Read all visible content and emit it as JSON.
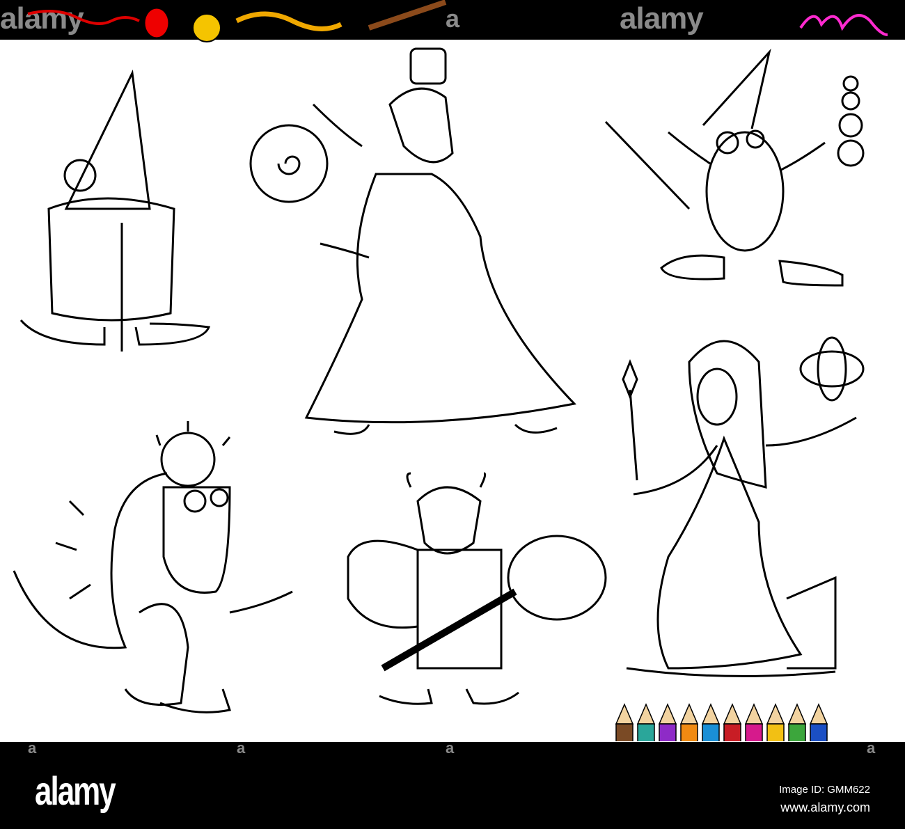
{
  "header": {
    "watermark_left": "alamy",
    "watermark_center": "alamy",
    "watermark_mark": "a"
  },
  "characters": [
    "gnome",
    "wizard",
    "imp-wizard",
    "dragon",
    "viking",
    "sorceress"
  ],
  "footer": {
    "logo": "alamy",
    "image_id": "Image ID: GMM622",
    "url": "www.alamy.com"
  },
  "pencil_colors": [
    "#7a4a25",
    "#2aa69a",
    "#8e2bc7",
    "#f08a12",
    "#1a8fd6",
    "#c81d25",
    "#d61a8c",
    "#f2c014",
    "#3ca63c",
    "#1b4fc4"
  ]
}
